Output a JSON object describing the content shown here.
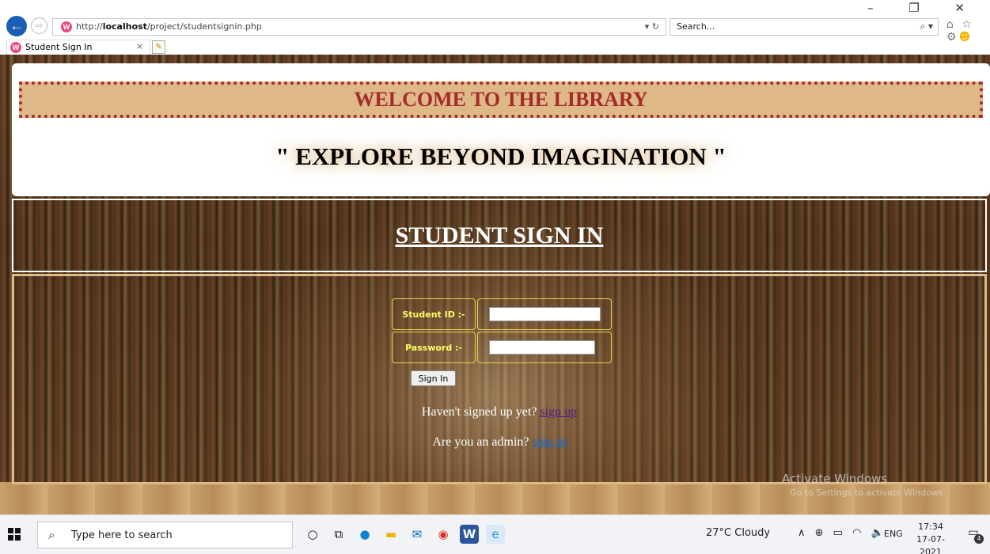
{
  "browser": {
    "url_prefix": "http://",
    "url_host": "localhost",
    "url_path": "/project/studentsignin.php",
    "address_actions": "▾ ↻",
    "search_placeholder": "Search...",
    "search_go": "⌕ ▾",
    "toolbar_icons": "⌂ ☆ ⚙",
    "smiley": "☻",
    "window_controls": "– ❐ ✕",
    "tab_title": "Student Sign In",
    "tab_close": "×",
    "new_tab": "✎"
  },
  "page": {
    "welcome": "WELCOME TO THE LIBRARY",
    "tagline": "\" EXPLORE BEYOND IMAGINATION \"",
    "heading": "STUDENT SIGN IN",
    "form": {
      "student_id_label": "Student ID :-",
      "student_id_value": "",
      "password_label": "Password :-",
      "password_value": "",
      "submit_label": "Sign In"
    },
    "signup_prompt": "Haven't signed up yet?",
    "signup_link": "sign up",
    "admin_prompt": "Are you an admin?",
    "admin_link": "sign in"
  },
  "watermark": {
    "title": "Activate Windows",
    "subtitle": "Go to Settings to activate Windows."
  },
  "taskbar": {
    "search_placeholder": "Type here to search",
    "weather": "27°C  Cloudy",
    "tray_icons": "∧ ⊕ ▭ ◠ 🔈",
    "language": "ENG",
    "time": "17:34",
    "date": "17-07-2021",
    "notification_count": "4"
  },
  "colors": {
    "banner_bg": "#deb887",
    "banner_text": "#a52a2a",
    "label_text": "#ffff66",
    "admin_link": "#0b6bd6",
    "signup_link": "#551a8b"
  }
}
